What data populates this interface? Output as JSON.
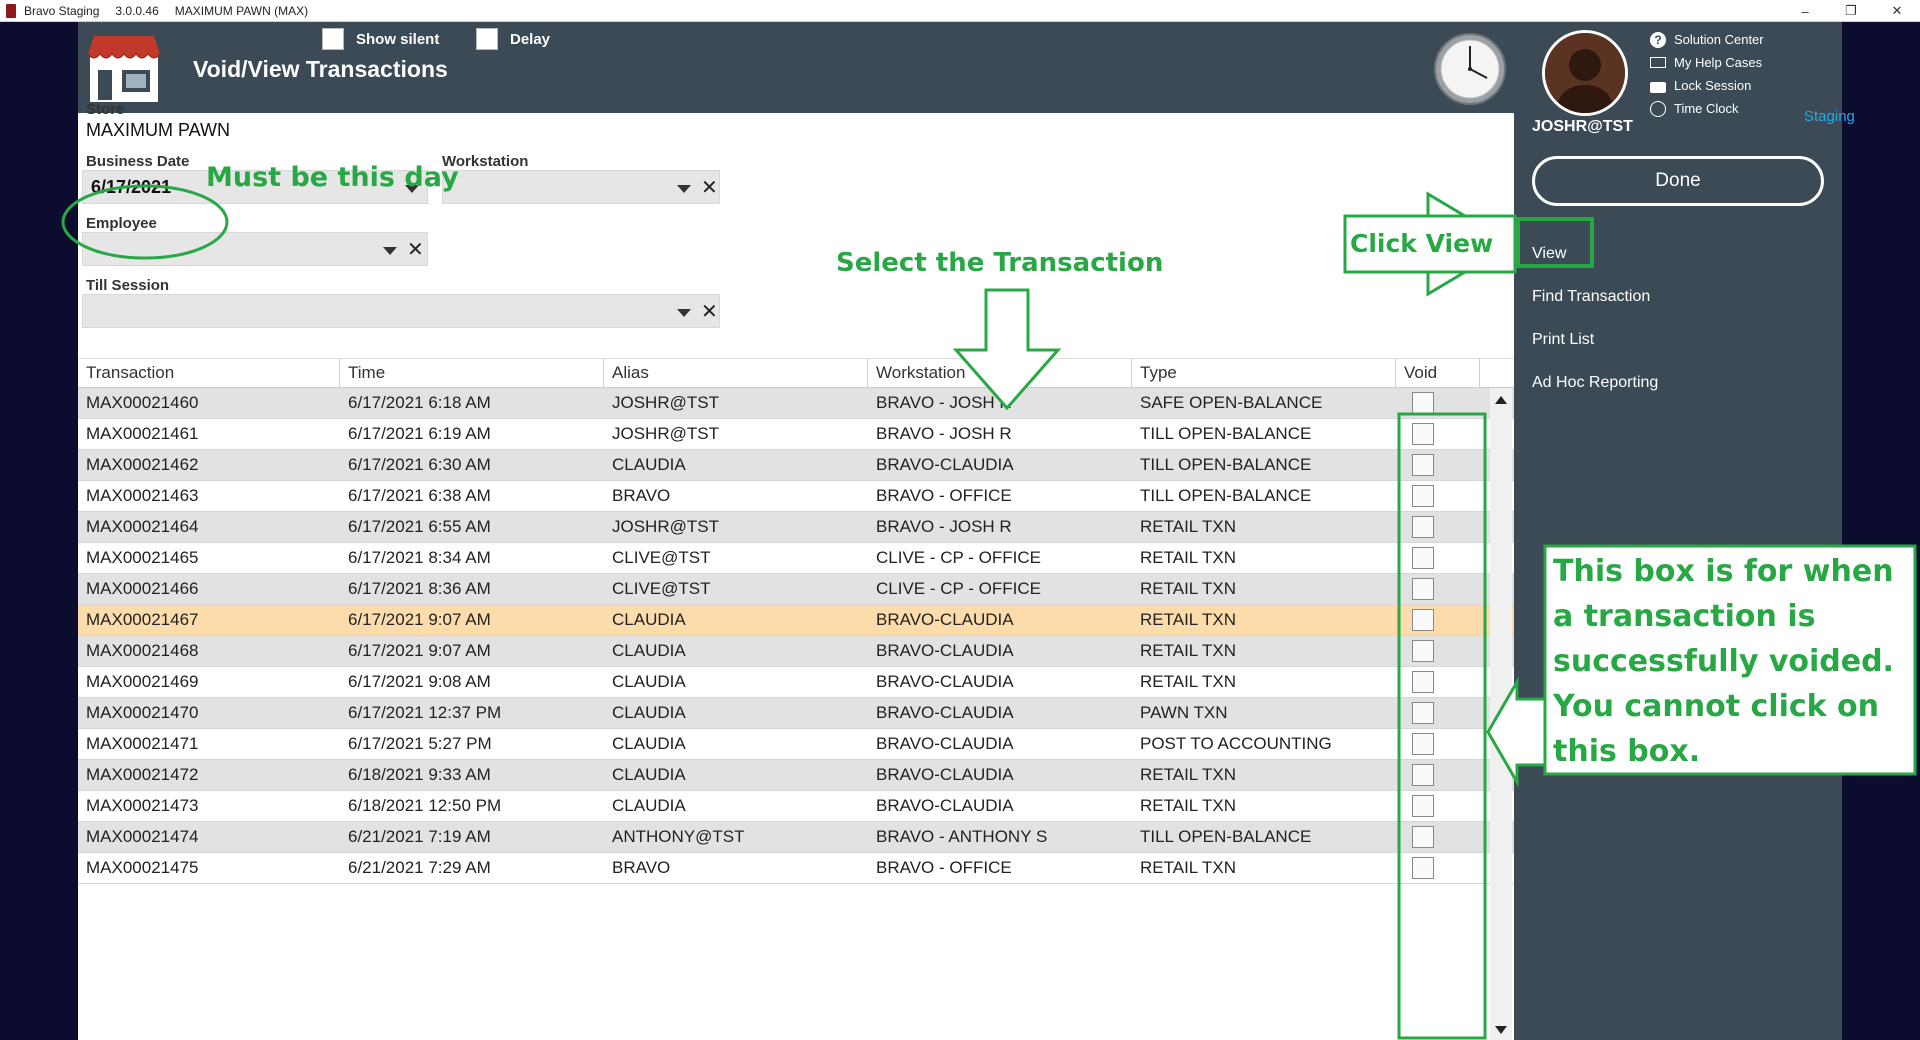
{
  "titlebar": {
    "app_name": "Bravo Staging",
    "version": "3.0.0.46",
    "store_label": "MAXIMUM PAWN (MAX)",
    "minimize": "–",
    "restore": "❐",
    "close": "✕"
  },
  "header": {
    "title": "Void/View Transactions",
    "show_silent_label": "Show silent",
    "delay_label": "Delay"
  },
  "filters": {
    "store_label": "Store",
    "store_value": "MAXIMUM PAWN",
    "business_date_label": "Business Date",
    "business_date_value": "6/17/2021",
    "workstation_label": "Workstation",
    "workstation_value": "",
    "employee_label": "Employee",
    "employee_value": "",
    "till_session_label": "Till Session",
    "till_session_value": ""
  },
  "user_panel": {
    "username": "JOSHR@TST",
    "environment": "Staging",
    "links": [
      "Solution Center",
      "My Help Cases",
      "Lock Session",
      "Time Clock"
    ],
    "done_label": "Done",
    "menu": [
      "View",
      "Find Transaction",
      "Print List",
      "Ad Hoc Reporting"
    ]
  },
  "table": {
    "columns": [
      "Transaction",
      "Time",
      "Alias",
      "Workstation",
      "Type",
      "Void"
    ],
    "rows": [
      [
        "MAX00021460",
        "6/17/2021 6:18 AM",
        "JOSHR@TST",
        "BRAVO - JOSH R",
        "SAFE OPEN-BALANCE"
      ],
      [
        "MAX00021461",
        "6/17/2021 6:19 AM",
        "JOSHR@TST",
        "BRAVO - JOSH R",
        "TILL OPEN-BALANCE"
      ],
      [
        "MAX00021462",
        "6/17/2021 6:30 AM",
        "CLAUDIA",
        "BRAVO-CLAUDIA",
        "TILL OPEN-BALANCE"
      ],
      [
        "MAX00021463",
        "6/17/2021 6:38 AM",
        "BRAVO",
        "BRAVO - OFFICE",
        "TILL OPEN-BALANCE"
      ],
      [
        "MAX00021464",
        "6/17/2021 6:55 AM",
        "JOSHR@TST",
        "BRAVO - JOSH R",
        "RETAIL TXN"
      ],
      [
        "MAX00021465",
        "6/17/2021 8:34 AM",
        "CLIVE@TST",
        "CLIVE - CP - OFFICE",
        "RETAIL TXN"
      ],
      [
        "MAX00021466",
        "6/17/2021 8:36 AM",
        "CLIVE@TST",
        "CLIVE - CP - OFFICE",
        "RETAIL TXN"
      ],
      [
        "MAX00021467",
        "6/17/2021 9:07 AM",
        "CLAUDIA",
        "BRAVO-CLAUDIA",
        "RETAIL TXN"
      ],
      [
        "MAX00021468",
        "6/17/2021 9:07 AM",
        "CLAUDIA",
        "BRAVO-CLAUDIA",
        "RETAIL TXN"
      ],
      [
        "MAX00021469",
        "6/17/2021 9:08 AM",
        "CLAUDIA",
        "BRAVO-CLAUDIA",
        "RETAIL TXN"
      ],
      [
        "MAX00021470",
        "6/17/2021 12:37 PM",
        "CLAUDIA",
        "BRAVO-CLAUDIA",
        "PAWN TXN"
      ],
      [
        "MAX00021471",
        "6/17/2021 5:27 PM",
        "CLAUDIA",
        "BRAVO-CLAUDIA",
        "POST TO ACCOUNTING"
      ],
      [
        "MAX00021472",
        "6/18/2021 9:33 AM",
        "CLAUDIA",
        "BRAVO-CLAUDIA",
        "RETAIL TXN"
      ],
      [
        "MAX00021473",
        "6/18/2021 12:50 PM",
        "CLAUDIA",
        "BRAVO-CLAUDIA",
        "RETAIL TXN"
      ],
      [
        "MAX00021474",
        "6/21/2021 7:19 AM",
        "ANTHONY@TST",
        "BRAVO - ANTHONY S",
        "TILL OPEN-BALANCE"
      ],
      [
        "MAX00021475",
        "6/21/2021 7:29 AM",
        "BRAVO",
        "BRAVO - OFFICE",
        "RETAIL TXN"
      ]
    ],
    "selected_row_index": 7
  },
  "annotations": {
    "must_be_this_day": "Must be this day",
    "select_transaction": "Select the Transaction",
    "click_view": "Click View",
    "void_box_note": "This box is for when a transaction is successfully voided. You cannot click on this box."
  },
  "colors": {
    "header_bg": "#3b4a54",
    "annotation_green": "#28a745",
    "selected_row": "#fddcab",
    "environment_blue": "#27a9e1"
  }
}
